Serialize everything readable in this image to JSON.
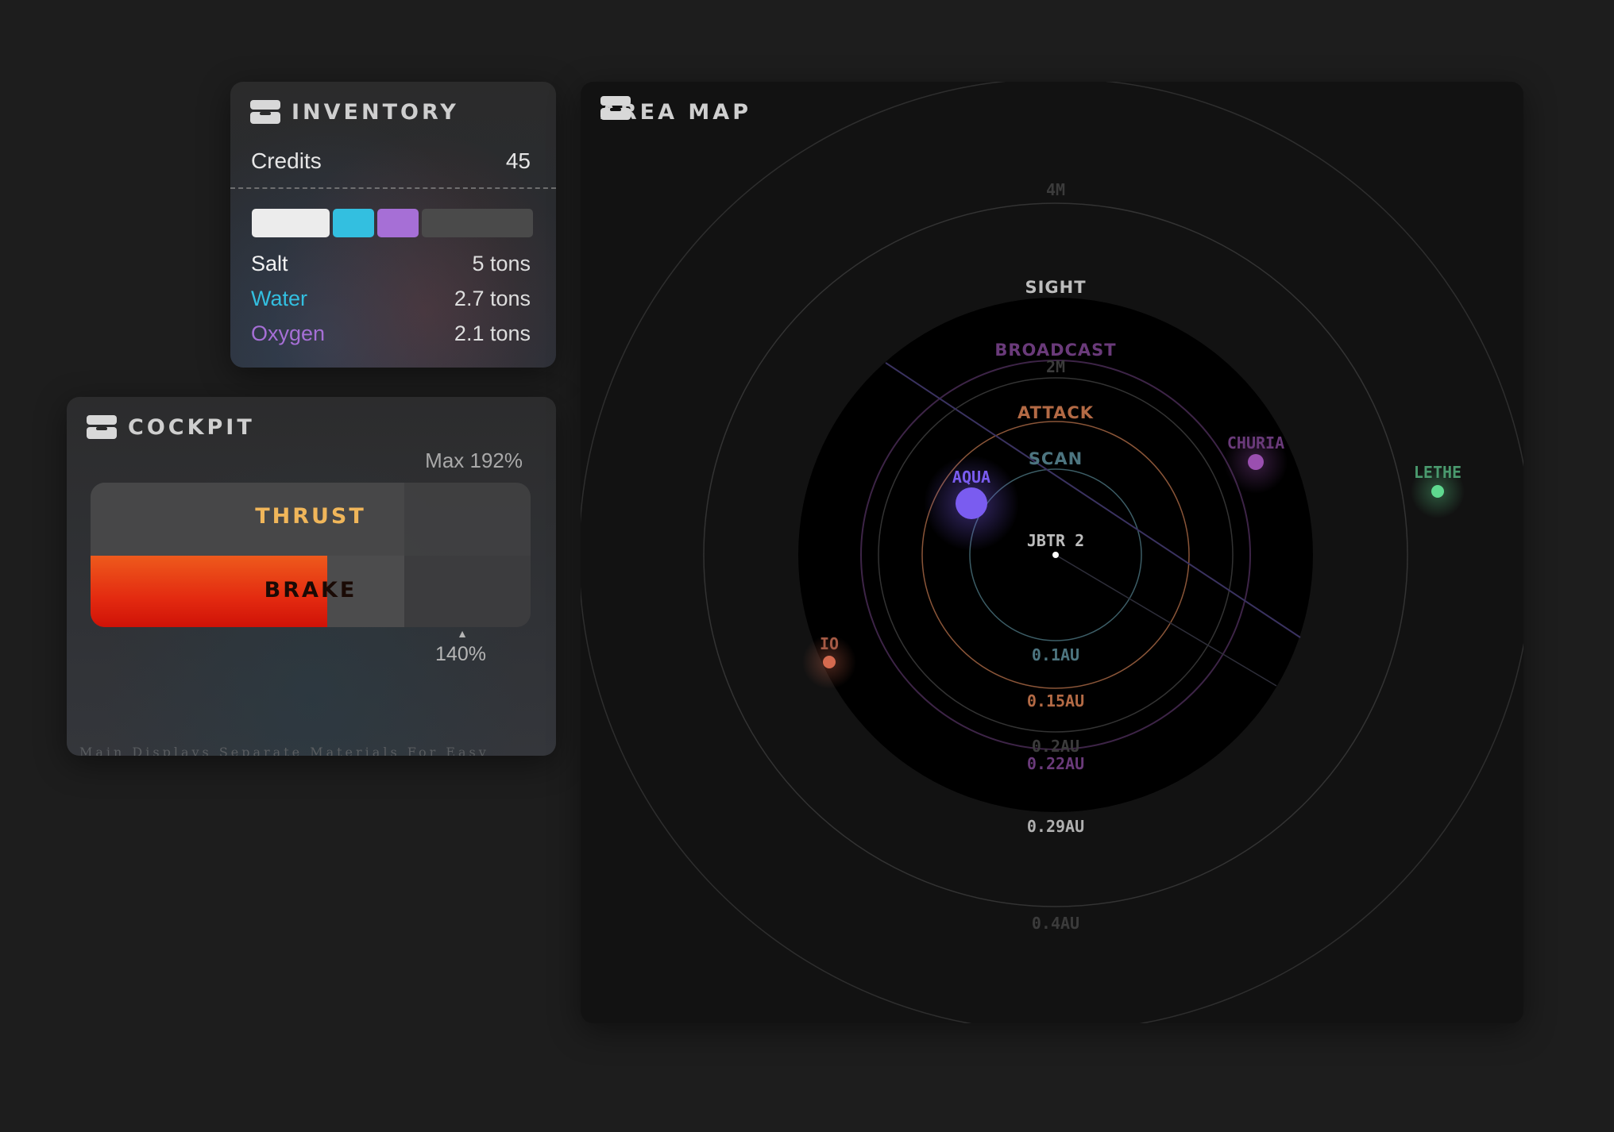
{
  "inventory": {
    "title": "INVENTORY",
    "credits_label": "Credits",
    "credits_value": "45",
    "resources": [
      {
        "name": "Salt",
        "value": "5 tons",
        "color": "#f2f2f2"
      },
      {
        "name": "Water",
        "value": "2.7 tons",
        "color": "#33bfe0"
      },
      {
        "name": "Oxygen",
        "value": "2.1 tons",
        "color": "#a66fd6"
      }
    ],
    "empty_color": "#4a4a4a"
  },
  "cockpit": {
    "title": "COCKPIT",
    "max_label": "Max 192%",
    "thrust_label": "THRUST",
    "brake_label": "BRAKE",
    "marker_value": "140%",
    "caption": "Main Displays Separate Materials For Easy",
    "thrust_color": "#f0b65a",
    "brake_color": "#e8431a"
  },
  "area_map": {
    "title": "AREA MAP",
    "center_label": "JBTR 2",
    "range_labels": [
      {
        "text": "SIGHT",
        "color": "#bdbdbd"
      },
      {
        "text": "BROADCAST",
        "color": "#6a3a7a"
      },
      {
        "text": "ATTACK",
        "color": "#b36a45"
      },
      {
        "text": "SCAN",
        "color": "#4d7580"
      }
    ],
    "distance_labels": [
      {
        "text": "4M",
        "color": "#3b3b3b"
      },
      {
        "text": "2M",
        "color": "#3b3b3b"
      },
      {
        "text": "0.1AU",
        "color": "#4d7580"
      },
      {
        "text": "0.15AU",
        "color": "#b36a45"
      },
      {
        "text": "0.2AU",
        "color": "#3b3b3b"
      },
      {
        "text": "0.22AU",
        "color": "#6a3a7a"
      },
      {
        "text": "0.29AU",
        "color": "#b0b0b0"
      },
      {
        "text": "0.4AU",
        "color": "#3b3b3b"
      }
    ],
    "bodies": [
      {
        "name": "AQUA",
        "color": "#7a5cf0",
        "label_color": "#7a5cf0"
      },
      {
        "name": "CHURIA",
        "color": "#9a4fb0",
        "label_color": "#6a3a7a"
      },
      {
        "name": "LETHE",
        "color": "#5fd98f",
        "label_color": "#4a9a6e"
      },
      {
        "name": "IO",
        "color": "#d46a4f",
        "label_color": "#a55a45"
      }
    ]
  }
}
